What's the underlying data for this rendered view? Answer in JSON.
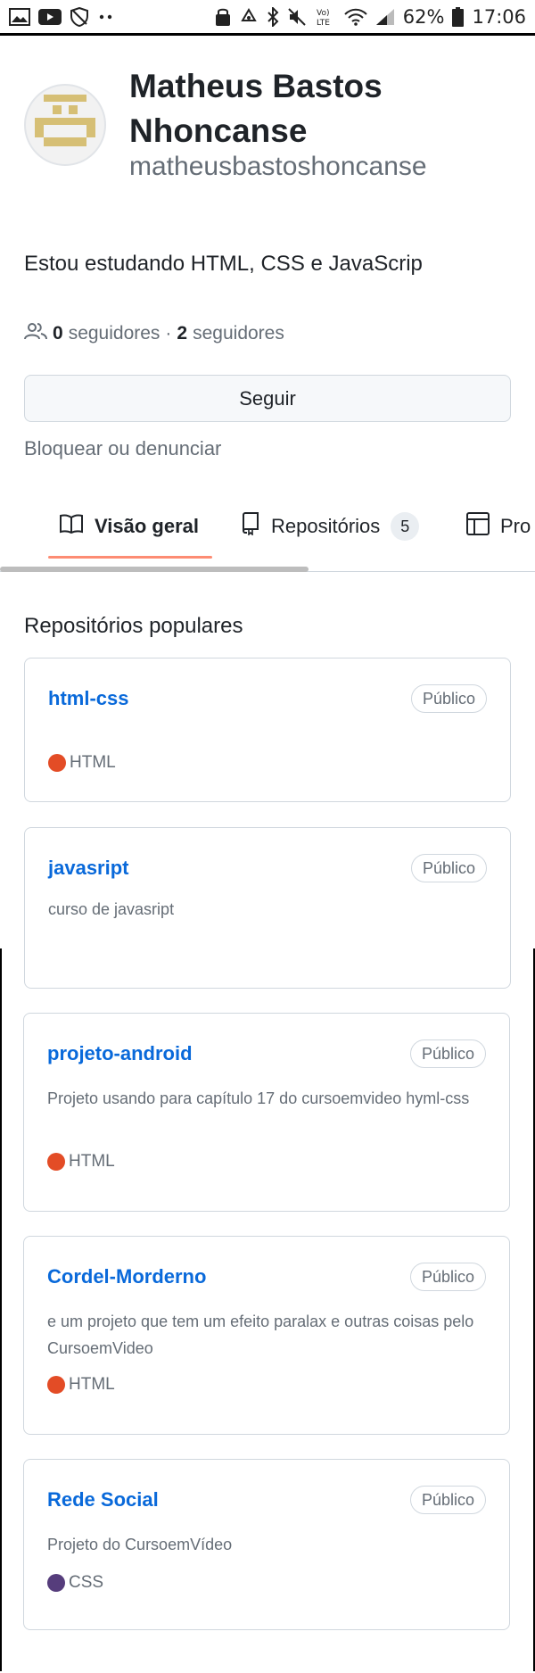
{
  "status_bar": {
    "left_icons": [
      "image-icon",
      "youtube-icon",
      "shield-icon",
      "more-dots-icon"
    ],
    "right_icons": [
      "lock-icon",
      "recycle-icon",
      "bluetooth-icon",
      "mute-icon",
      "volte-icon",
      "wifi-icon",
      "signal-icon"
    ],
    "volte_label": "Vo)\nLTE",
    "battery": "62%",
    "time": "17:06"
  },
  "profile": {
    "name": "Matheus Bastos Nhoncanse",
    "username": "matheusbastoshoncanse",
    "bio": "Estou estudando HTML, CSS e JavaScrip",
    "followers_count": "0",
    "followers_label": "seguidores",
    "separator": "·",
    "following_count": "2",
    "following_label": "seguidores",
    "follow_button": "Seguir",
    "block_link": "Bloquear ou denunciar"
  },
  "tabs": [
    {
      "label": "Visão geral",
      "icon": "book-icon",
      "active": true
    },
    {
      "label": "Repositórios",
      "icon": "repo-icon",
      "count": "5"
    },
    {
      "label": "Pro",
      "icon": "table-icon"
    }
  ],
  "section_title": "Repositórios populares",
  "colors": {
    "link": "#0969da",
    "tab_underline": "#fd8c73",
    "html_lang": "#e34c26",
    "css_lang": "#563d7c"
  },
  "repos": [
    {
      "name": "html-css",
      "visibility": "Público",
      "description": "",
      "language": "HTML",
      "lang_color": "#e34c26"
    },
    {
      "name": "javasript",
      "visibility": "Público",
      "description": "curso de javasript",
      "language": "",
      "lang_color": ""
    },
    {
      "name": "projeto-android",
      "visibility": "Público",
      "description": "Projeto usando para capítulo 17 do cursoemvideo hyml-css",
      "language": "HTML",
      "lang_color": "#e34c26"
    },
    {
      "name": "Cordel-Morderno",
      "visibility": "Público",
      "description": "e um projeto que tem um efeito paralax e outras coisas pelo CursoemVideo",
      "language": "HTML",
      "lang_color": "#e34c26"
    },
    {
      "name": "Rede Social",
      "visibility": "Público",
      "description": "Projeto do CursoemVídeo",
      "language": "CSS",
      "lang_color": "#563d7c"
    }
  ]
}
